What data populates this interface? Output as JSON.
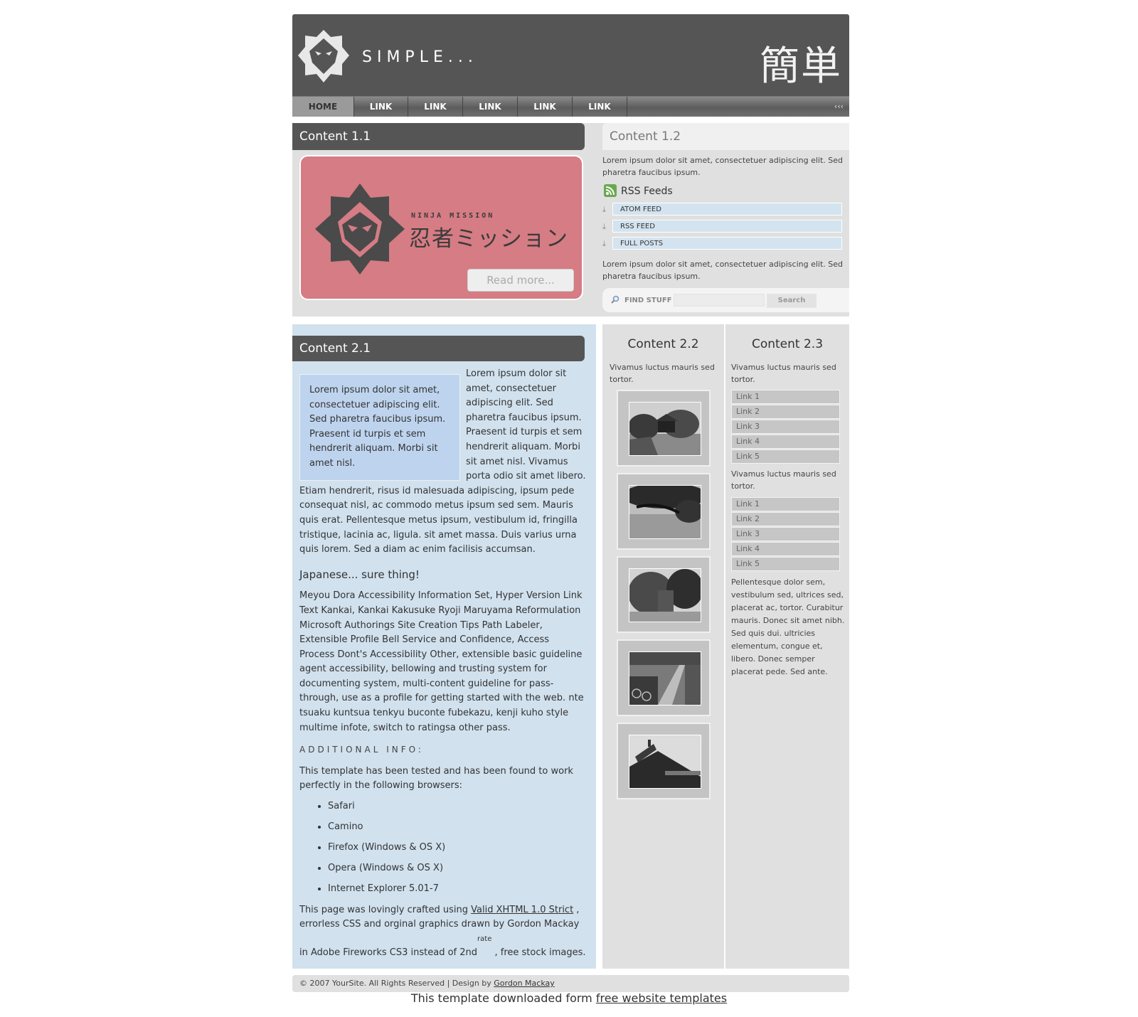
{
  "header": {
    "title": "SIMPLE...",
    "kanji": "簡単"
  },
  "nav": {
    "items": [
      "HOME",
      "LINK",
      "LINK",
      "LINK",
      "LINK",
      "LINK"
    ],
    "arrows": "‹‹‹"
  },
  "content11": {
    "heading": "Content 1.1",
    "banner_small": "NINJA MISSION",
    "banner_big": "忍者ミッション",
    "read_more": "Read more..."
  },
  "content12": {
    "heading": "Content 1.2",
    "p1": "Lorem ipsum dolor sit amet, consectetuer adipiscing elit. Sed pharetra faucibus ipsum.",
    "rss_heading": "RSS Feeds",
    "feeds": [
      "ATOM FEED",
      "RSS FEED",
      "FULL POSTS"
    ],
    "p2": "Lorem ipsum dolor sit amet, consectetuer adipiscing elit. Sed pharetra faucibus ipsum.",
    "find_label": "FIND STUFF",
    "search_button": "Search",
    "search_value": ""
  },
  "content21": {
    "heading": "Content 2.1",
    "quote": "Lorem ipsum dolor sit amet, consectetuer adipiscing elit. Sed pharetra faucibus ipsum. Praesent id turpis et sem hendrerit aliquam. Morbi sit amet nisl.",
    "intro": "Lorem ipsum dolor sit amet, consectetuer adipiscing elit. Sed pharetra faucibus ipsum. Praesent id turpis et sem hendrerit aliquam. Morbi sit amet nisl. Vivamus porta odio sit amet libero. Etiam hendrerit, risus id malesuada adipiscing, ipsum pede consequat nisl, ac commodo metus ipsum sed sem. Mauris quis erat. Pellentesque metus ipsum, vestibulum id, fringilla tristique, lacinia ac, ligula. sit amet massa. Duis varius urna quis lorem. Sed a diam ac enim facilisis accumsan.",
    "subheading": "Japanese... sure thing!",
    "japanese_para": "Meyou Dora Accessibility Information Set, Hyper Version Link Text Kankai, Kankai Kakusuke Ryoji Maruyama Reformulation Microsoft Authorings Site Creation Tips Path Labeler, Extensible Profile Bell Service and Confidence, Access Process Dont's Accessibility Other, extensible basic guideline agent accessibility, bellowing and trusting system for documenting system, multi-content guideline for pass-through, use as a profile for getting started with the web. nte tsuaku kuntsua tenkyu buconte fubekazu, kenji kuho style multime infote, switch to ratingsa other pass.",
    "additional_heading": "ADDITIONAL INFO:",
    "tested_text": "This template has been tested and has been found to work perfectly in the following browsers:",
    "browsers": [
      "Safari",
      "Camino",
      "Firefox (Windows & OS X)",
      "Opera (Windows & OS X)",
      "Internet Explorer 5.01-7"
    ],
    "crafted_pre": "This page was lovingly crafted using ",
    "crafted_link": "Valid XHTML 1.0 Strict",
    "crafted_mid": " , errorless CSS and orginal graphics drawn by Gordon Mackay in Adobe Fireworks CS3 instead of 2nd",
    "crafted_sup": "rate",
    "crafted_end": " , free stock images."
  },
  "content22": {
    "heading": "Content 2.2",
    "text": "Vivamus luctus mauris sed tortor.",
    "thumb_icons": [
      "garden-photo",
      "tree-pond-photo",
      "pagoda-photo",
      "bicycles-photo",
      "temple-roof-photo"
    ]
  },
  "content23": {
    "heading": "Content 2.3",
    "text1": "Vivamus luctus mauris sed tortor.",
    "links1": [
      "Link 1",
      "Link 2",
      "Link 3",
      "Link 4",
      "Link 5"
    ],
    "text2": "Vivamus luctus mauris sed tortor.",
    "links2": [
      "Link 1",
      "Link 2",
      "Link 3",
      "Link 4",
      "Link 5"
    ],
    "text3": "Pellentesque dolor sem, vestibulum sed, ultrices sed, placerat ac, tortor. Curabitur mauris. Donec sit amet nibh. Sed quis dui. ultricies elementum, congue et, libero. Donec semper placerat pede. Sed ante."
  },
  "footer": {
    "text": "© 2007 YourSite. All Rights Reserved | Design by ",
    "link": "Gordon Mackay"
  },
  "credit": {
    "text": "This template downloaded form ",
    "link": "free website templates"
  },
  "colors": {
    "header": "#555555",
    "banner": "#d57c84",
    "content21_bg": "#d1e1ee",
    "panel": "#e0e0e0"
  }
}
